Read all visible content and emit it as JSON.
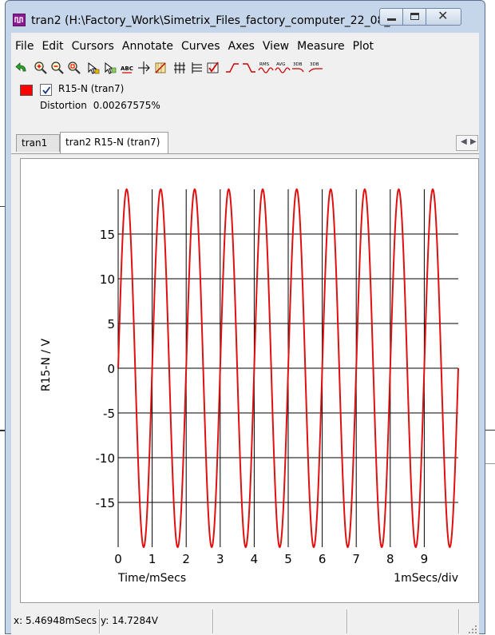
{
  "window": {
    "title": "tran2 (H:\\Factory_Work\\Simetrix_Files_factory_computer_22_08_0..."
  },
  "menu": [
    "File",
    "Edit",
    "Cursors",
    "Annotate",
    "Curves",
    "Axes",
    "View",
    "Measure",
    "Plot"
  ],
  "toolbar": {
    "icons": [
      "undo-icon",
      "zoom-in-icon",
      "zoom-out-icon",
      "zoom-full-icon",
      "cursor-icon",
      "cursor2-icon",
      "abc-label-icon",
      "crosshair-icon",
      "cross-icon",
      "grid-icon",
      "horizontal-lines-icon",
      "grid-check-icon",
      "rise-icon",
      "fall-icon",
      "rms-icon",
      "avg-icon",
      "3db-icon",
      "3db-low-icon"
    ],
    "rms_text": "RMS",
    "avg_text": "AVG",
    "db_text": "3DB",
    "db2_text": "3DB"
  },
  "legend": {
    "color": "#ff0000",
    "checked": true,
    "name": "R15-N (tran7)",
    "measure_label": "Distortion",
    "measure_value": "0.00267575%"
  },
  "tabs": [
    {
      "label": "tran1",
      "active": false
    },
    {
      "label": "tran2 R15-N (tran7)",
      "active": true
    }
  ],
  "chart_data": {
    "type": "line",
    "title": "",
    "xlabel": "Time/mSecs",
    "ylabel": "R15-N / V",
    "x_scale_note": "1mSecs/div",
    "xlim": [
      0,
      10
    ],
    "ylim": [
      -20,
      20
    ],
    "x_ticks": [
      "0",
      "1",
      "2",
      "3",
      "4",
      "5",
      "6",
      "7",
      "8",
      "9"
    ],
    "y_ticks": [
      "15",
      "10",
      "5",
      "0",
      "-5",
      "-10",
      "-15"
    ],
    "grid": true,
    "series": [
      {
        "name": "R15-N (tran7)",
        "color": "#e01010",
        "function": "sine",
        "amplitude": 20,
        "frequency_khz": 1,
        "phase_deg": 0,
        "x_end": 10
      }
    ]
  },
  "status": {
    "x": "x: 5.46948mSecs",
    "y": "y: 14.7284V"
  }
}
